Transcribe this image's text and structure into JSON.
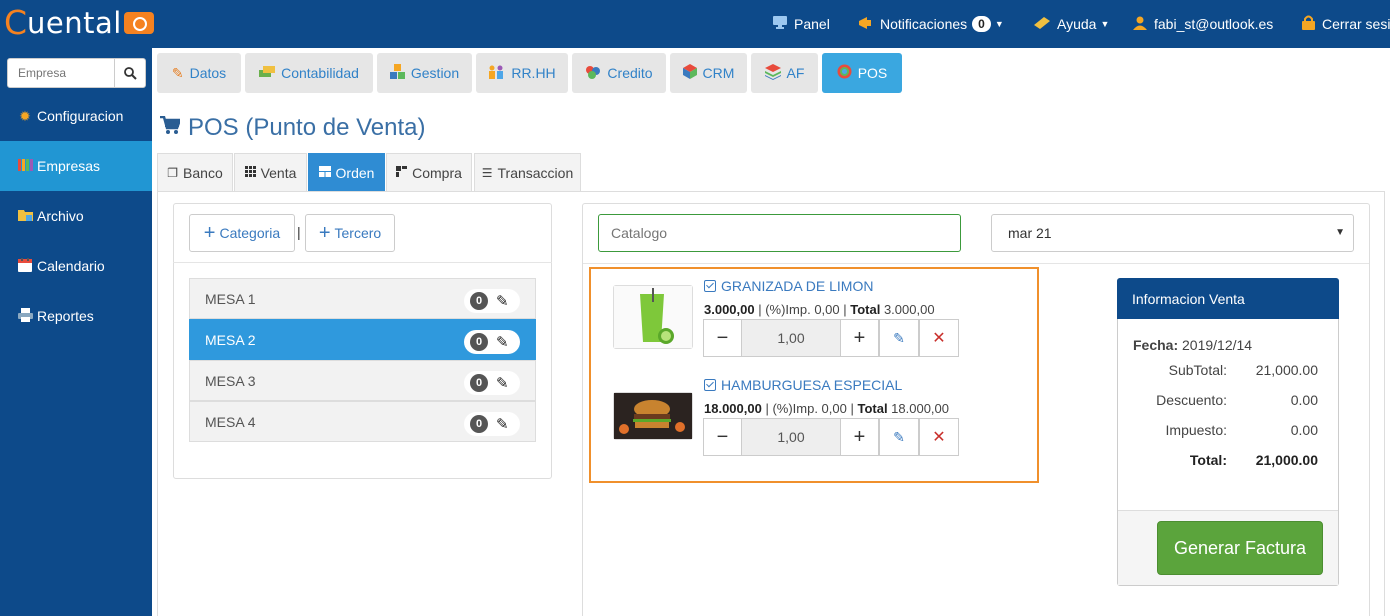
{
  "brand": {
    "first_letter": "C",
    "rest": "uental"
  },
  "topnav": {
    "panel": "Panel",
    "notificaciones": "Notificaciones",
    "notif_count": "0",
    "ayuda": "Ayuda",
    "user": "fabi_st@outlook.es",
    "cerrar": "Cerrar sesi"
  },
  "sidebar": {
    "search_placeholder": "Empresa",
    "items": [
      {
        "label": "Configuracion",
        "icon": "gear-icon"
      },
      {
        "label": "Empresas",
        "icon": "books-icon",
        "active": true
      },
      {
        "label": "Archivo",
        "icon": "folder-icon"
      },
      {
        "label": "Calendario",
        "icon": "calendar-icon"
      },
      {
        "label": "Reportes",
        "icon": "printer-icon"
      }
    ]
  },
  "modules": [
    {
      "label": "Datos",
      "icon": "pencil-icon"
    },
    {
      "label": "Contabilidad",
      "icon": "money-icon"
    },
    {
      "label": "Gestion",
      "icon": "blocks-icon"
    },
    {
      "label": "RR.HH",
      "icon": "people-icon"
    },
    {
      "label": "Credito",
      "icon": "coins-icon"
    },
    {
      "label": "CRM",
      "icon": "cube-icon"
    },
    {
      "label": "AF",
      "icon": "layers-icon"
    },
    {
      "label": "POS",
      "icon": "pos-icon",
      "active": true
    }
  ],
  "page": {
    "title": "POS (Punto de Venta)"
  },
  "subtabs": [
    {
      "label": "Banco",
      "icon": "window-icon"
    },
    {
      "label": "Venta",
      "icon": "grid-icon"
    },
    {
      "label": "Orden",
      "icon": "layout-icon",
      "active": true
    },
    {
      "label": "Compra",
      "icon": "blocks-small-icon"
    },
    {
      "label": "Transaccion",
      "icon": "list-icon"
    }
  ],
  "left": {
    "categoria": "Categoria",
    "separator": "|",
    "tercero": "Tercero",
    "mesas": [
      {
        "label": "MESA 1",
        "count": "0"
      },
      {
        "label": "MESA 2",
        "count": "0",
        "active": true
      },
      {
        "label": "MESA 3",
        "count": "0"
      },
      {
        "label": "MESA 4",
        "count": "0"
      }
    ]
  },
  "catalog": {
    "placeholder": "Catalogo",
    "date_value": "mar 21"
  },
  "products": [
    {
      "name": "GRANIZADA DE LIMON",
      "price": "3.000,00",
      "imp_label": " | (%)Imp. 0,00 | ",
      "total_label": "Total",
      "total": " 3.000,00",
      "qty": "1,00"
    },
    {
      "name": "HAMBURGUESA ESPECIAL",
      "price": "18.000,00",
      "imp_label": " | (%)Imp. 0,00 | ",
      "total_label": "Total",
      "total": " 18.000,00",
      "qty": "1,00"
    }
  ],
  "info": {
    "title": "Informacion Venta",
    "fecha_label": "Fecha:",
    "fecha_value": " 2019/12/14",
    "subtotal_label": "SubTotal:",
    "subtotal_value": "21,000.00",
    "descuento_label": "Descuento:",
    "descuento_value": "0.00",
    "impuesto_label": "Impuesto:",
    "impuesto_value": "0.00",
    "total_label": "Total:",
    "total_value": "21,000.00",
    "button": "Generar Factura"
  }
}
